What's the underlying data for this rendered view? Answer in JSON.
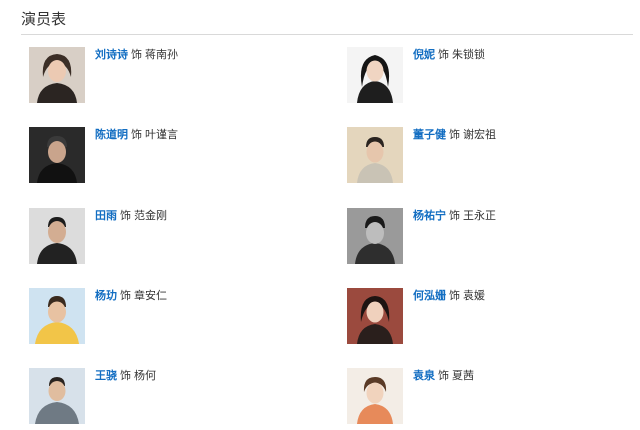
{
  "section": {
    "title": "演员表"
  },
  "cast": [
    {
      "actor": "刘诗诗",
      "sep": "饰",
      "role": "蒋南孙"
    },
    {
      "actor": "倪妮",
      "sep": "饰",
      "role": "朱锁锁"
    },
    {
      "actor": "陈道明",
      "sep": "饰",
      "role": "叶谨言"
    },
    {
      "actor": "董子健",
      "sep": "饰",
      "role": "谢宏祖"
    },
    {
      "actor": "田雨",
      "sep": "饰",
      "role": "范金刚"
    },
    {
      "actor": "杨祐宁",
      "sep": "饰",
      "role": "王永正"
    },
    {
      "actor": "杨玏",
      "sep": "饰",
      "role": "章安仁"
    },
    {
      "actor": "何泓姗",
      "sep": "饰",
      "role": "袁媛"
    },
    {
      "actor": "王骁",
      "sep": "饰",
      "role": "杨何"
    },
    {
      "actor": "袁泉",
      "sep": "饰",
      "role": "夏茜"
    }
  ],
  "colors": {
    "actor_link": "#136ec2",
    "divider": "#d9d9d9",
    "text": "#333333"
  }
}
